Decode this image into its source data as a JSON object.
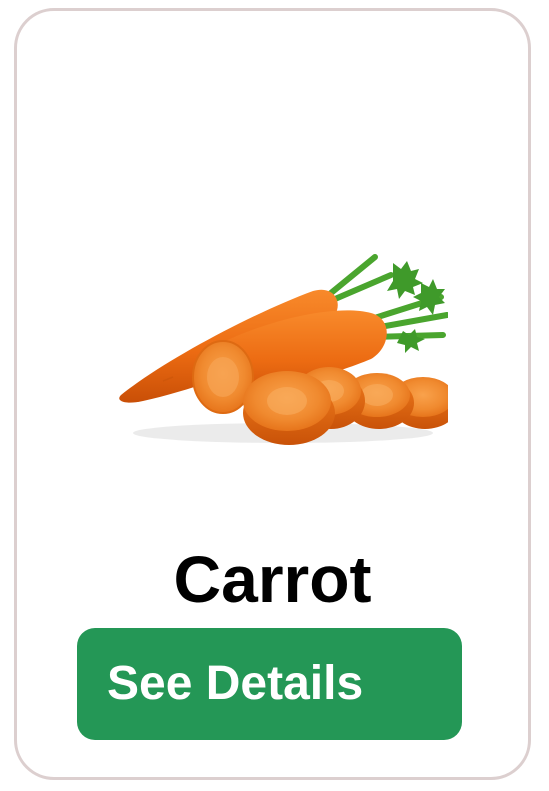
{
  "product": {
    "name": "Carrot",
    "image_icon": "carrot-image"
  },
  "actions": {
    "details_label": "See Details"
  },
  "colors": {
    "card_border": "#dccfcf",
    "button_background": "#249756",
    "button_text": "#ffffff",
    "title_text": "#000000"
  }
}
